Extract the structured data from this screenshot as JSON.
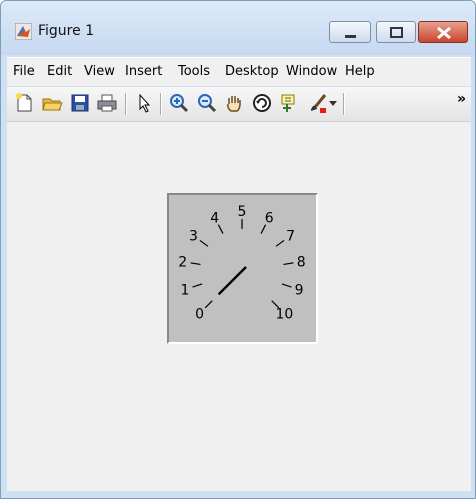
{
  "window": {
    "title": "Figure 1"
  },
  "menu": [
    "File",
    "Edit",
    "View",
    "Insert",
    "Tools",
    "Desktop",
    "Window",
    "Help"
  ],
  "toolbar": {
    "buttons": [
      "new-figure",
      "open-file",
      "save",
      "print",
      "edit-plot-arrow",
      "zoom-in",
      "zoom-out",
      "pan",
      "rotate-3d",
      "data-cursor",
      "brush"
    ],
    "overflow_label": "»"
  },
  "gauge": {
    "scale_labels": [
      "0",
      "1",
      "2",
      "3",
      "4",
      "5",
      "6",
      "7",
      "8",
      "9",
      "10"
    ],
    "needle_value": 0,
    "min": 0,
    "max": 10
  }
}
